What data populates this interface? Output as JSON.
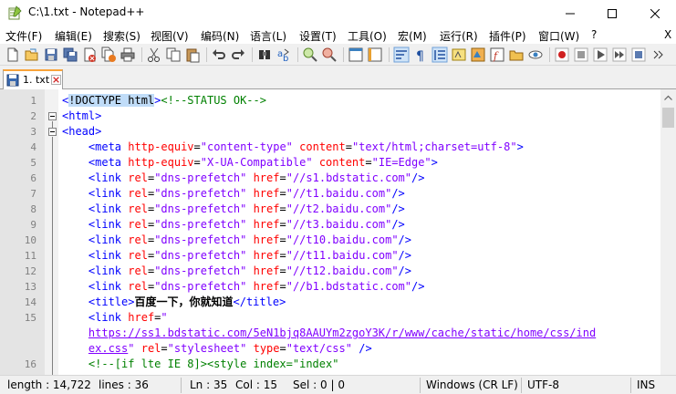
{
  "window": {
    "title": "C:\\1.txt - Notepad++",
    "minimize_glyph": "—",
    "maximize_glyph": "☐",
    "close_glyph": "✕"
  },
  "menu": {
    "items": [
      "文件(F)",
      "编辑(E)",
      "搜索(S)",
      "视图(V)",
      "编码(N)",
      "语言(L)",
      "设置(T)",
      "工具(O)",
      "宏(M)",
      "运行(R)",
      "插件(P)",
      "窗口(W)",
      "?"
    ],
    "close_label": "X"
  },
  "toolbar": {
    "buttons": [
      "new-file-icon",
      "open-file-icon",
      "save-icon",
      "save-all-icon",
      "close-icon",
      "close-all-icon",
      "print-icon",
      "cut-icon",
      "copy-icon",
      "paste-icon",
      "undo-icon",
      "redo-icon",
      "find-icon",
      "replace-icon",
      "zoom-in-icon",
      "zoom-out-icon",
      "sync-vertical-icon",
      "sync-horizontal-icon",
      "word-wrap-icon",
      "show-all-chars-icon",
      "indent-guide-icon",
      "define-language-icon",
      "doc-map-icon",
      "function-list-icon",
      "folder-workspace-icon",
      "monitoring-icon",
      "record-macro-icon",
      "stop-macro-icon",
      "play-macro-icon",
      "run-macro-multiple-icon",
      "save-macro-icon"
    ]
  },
  "tabs": [
    {
      "label": "1. txt"
    }
  ],
  "editor": {
    "line_numbers": [
      "1",
      "2",
      "3",
      "4",
      "5",
      "6",
      "7",
      "8",
      "9",
      "10",
      "11",
      "12",
      "13",
      "14",
      "15",
      "",
      "",
      "16"
    ],
    "lines": [
      [
        [
          "tag",
          "<"
        ],
        [
          "hl",
          "!DOCTYPE html"
        ],
        [
          "tag",
          ">"
        ],
        [
          "cmt",
          "<!--STATUS OK-->"
        ]
      ],
      [
        [
          "tag",
          "<html>"
        ]
      ],
      [
        [
          "tag",
          "<head>"
        ]
      ],
      [
        [
          "text",
          "    "
        ],
        [
          "tag",
          "<meta "
        ],
        [
          "attr",
          "http-equiv"
        ],
        [
          "text",
          "="
        ],
        [
          "val",
          "\"content-type\""
        ],
        [
          "text",
          " "
        ],
        [
          "attr",
          "content"
        ],
        [
          "text",
          "="
        ],
        [
          "val",
          "\"text/html;charset=utf-8\""
        ],
        [
          "tag",
          ">"
        ]
      ],
      [
        [
          "text",
          "    "
        ],
        [
          "tag",
          "<meta "
        ],
        [
          "attr",
          "http-equiv"
        ],
        [
          "text",
          "="
        ],
        [
          "val",
          "\"X-UA-Compatible\""
        ],
        [
          "text",
          " "
        ],
        [
          "attr",
          "content"
        ],
        [
          "text",
          "="
        ],
        [
          "val",
          "\"IE=Edge\""
        ],
        [
          "tag",
          ">"
        ]
      ],
      [
        [
          "text",
          "    "
        ],
        [
          "tag",
          "<link "
        ],
        [
          "attr",
          "rel"
        ],
        [
          "text",
          "="
        ],
        [
          "val",
          "\"dns-prefetch\""
        ],
        [
          "text",
          " "
        ],
        [
          "attr",
          "href"
        ],
        [
          "text",
          "="
        ],
        [
          "val",
          "\"//s1.bdstatic.com\""
        ],
        [
          "tag",
          "/>"
        ]
      ],
      [
        [
          "text",
          "    "
        ],
        [
          "tag",
          "<link "
        ],
        [
          "attr",
          "rel"
        ],
        [
          "text",
          "="
        ],
        [
          "val",
          "\"dns-prefetch\""
        ],
        [
          "text",
          " "
        ],
        [
          "attr",
          "href"
        ],
        [
          "text",
          "="
        ],
        [
          "val",
          "\"//t1.baidu.com\""
        ],
        [
          "tag",
          "/>"
        ]
      ],
      [
        [
          "text",
          "    "
        ],
        [
          "tag",
          "<link "
        ],
        [
          "attr",
          "rel"
        ],
        [
          "text",
          "="
        ],
        [
          "val",
          "\"dns-prefetch\""
        ],
        [
          "text",
          " "
        ],
        [
          "attr",
          "href"
        ],
        [
          "text",
          "="
        ],
        [
          "val",
          "\"//t2.baidu.com\""
        ],
        [
          "tag",
          "/>"
        ]
      ],
      [
        [
          "text",
          "    "
        ],
        [
          "tag",
          "<link "
        ],
        [
          "attr",
          "rel"
        ],
        [
          "text",
          "="
        ],
        [
          "val",
          "\"dns-prefetch\""
        ],
        [
          "text",
          " "
        ],
        [
          "attr",
          "href"
        ],
        [
          "text",
          "="
        ],
        [
          "val",
          "\"//t3.baidu.com\""
        ],
        [
          "tag",
          "/>"
        ]
      ],
      [
        [
          "text",
          "    "
        ],
        [
          "tag",
          "<link "
        ],
        [
          "attr",
          "rel"
        ],
        [
          "text",
          "="
        ],
        [
          "val",
          "\"dns-prefetch\""
        ],
        [
          "text",
          " "
        ],
        [
          "attr",
          "href"
        ],
        [
          "text",
          "="
        ],
        [
          "val",
          "\"//t10.baidu.com\""
        ],
        [
          "tag",
          "/>"
        ]
      ],
      [
        [
          "text",
          "    "
        ],
        [
          "tag",
          "<link "
        ],
        [
          "attr",
          "rel"
        ],
        [
          "text",
          "="
        ],
        [
          "val",
          "\"dns-prefetch\""
        ],
        [
          "text",
          " "
        ],
        [
          "attr",
          "href"
        ],
        [
          "text",
          "="
        ],
        [
          "val",
          "\"//t11.baidu.com\""
        ],
        [
          "tag",
          "/>"
        ]
      ],
      [
        [
          "text",
          "    "
        ],
        [
          "tag",
          "<link "
        ],
        [
          "attr",
          "rel"
        ],
        [
          "text",
          "="
        ],
        [
          "val",
          "\"dns-prefetch\""
        ],
        [
          "text",
          " "
        ],
        [
          "attr",
          "href"
        ],
        [
          "text",
          "="
        ],
        [
          "val",
          "\"//t12.baidu.com\""
        ],
        [
          "tag",
          "/>"
        ]
      ],
      [
        [
          "text",
          "    "
        ],
        [
          "tag",
          "<link "
        ],
        [
          "attr",
          "rel"
        ],
        [
          "text",
          "="
        ],
        [
          "val",
          "\"dns-prefetch\""
        ],
        [
          "text",
          " "
        ],
        [
          "attr",
          "href"
        ],
        [
          "text",
          "="
        ],
        [
          "val",
          "\"//b1.bdstatic.com\""
        ],
        [
          "tag",
          "/>"
        ]
      ],
      [
        [
          "text",
          "    "
        ],
        [
          "tag",
          "<title>"
        ],
        [
          "bold",
          "百度一下，你就知道"
        ],
        [
          "tag",
          "</title>"
        ]
      ],
      [
        [
          "text",
          "    "
        ],
        [
          "tag",
          "<link "
        ],
        [
          "attr",
          "href"
        ],
        [
          "text",
          "="
        ],
        [
          "val",
          "\""
        ]
      ],
      [
        [
          "text",
          "    "
        ],
        [
          "url",
          "https://ss1.bdstatic.com/5eN1bjq8AAUYm2zgoY3K/r/www/cache/static/home/css/ind"
        ]
      ],
      [
        [
          "text",
          "    "
        ],
        [
          "url",
          "ex.css"
        ],
        [
          "val",
          "\""
        ],
        [
          "text",
          " "
        ],
        [
          "attr",
          "rel"
        ],
        [
          "text",
          "="
        ],
        [
          "val",
          "\"stylesheet\""
        ],
        [
          "text",
          " "
        ],
        [
          "attr",
          "type"
        ],
        [
          "text",
          "="
        ],
        [
          "val",
          "\"text/css\""
        ],
        [
          "text",
          " "
        ],
        [
          "tag",
          "/>"
        ]
      ],
      [
        [
          "text",
          "    "
        ],
        [
          "cmt",
          "<!--[if lte IE 8]><style index=\"index\""
        ]
      ]
    ]
  },
  "colors": {
    "tag": "#0000ff",
    "attr": "#ff0000",
    "value": "#8000ff",
    "comment": "#008000",
    "tab_accent": "#f9a33a"
  },
  "status": {
    "length": "length : 14,722",
    "lines": "lines : 36",
    "ln": "Ln : 35",
    "col": "Col : 15",
    "sel": "Sel : 0 | 0",
    "eol": "Windows (CR LF)",
    "encoding": "UTF-8",
    "mode": "INS"
  }
}
